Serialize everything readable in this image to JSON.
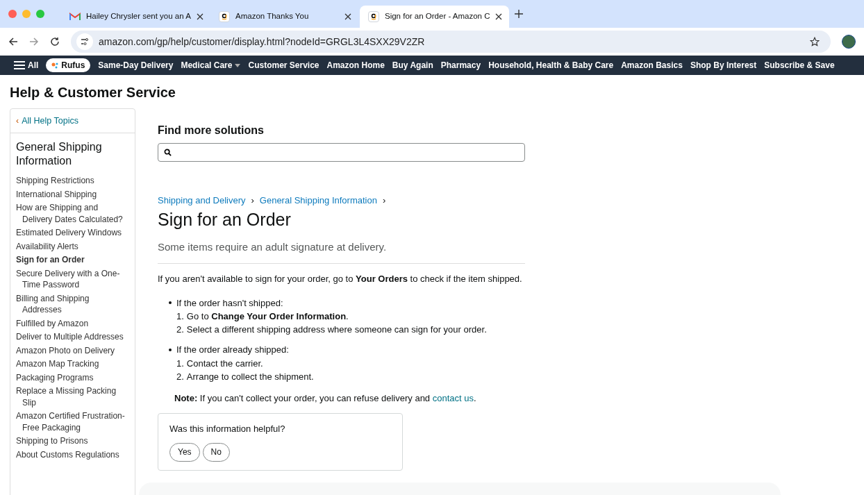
{
  "browser": {
    "tabs": [
      {
        "title": "Hailey Chrysler sent you an A",
        "kind": "mail",
        "selected": false
      },
      {
        "title": "Amazon Thanks You",
        "kind": "amazon",
        "selected": false
      },
      {
        "title": "Sign for an Order - Amazon C",
        "kind": "amazon",
        "selected": true
      }
    ],
    "url": "amazon.com/gp/help/customer/display.html?nodeId=GRGL3L4SXX29V2ZR"
  },
  "nav": {
    "all": "All",
    "rufus": "Rufus",
    "items": [
      {
        "label": "Same-Day Delivery",
        "dropdown": false
      },
      {
        "label": "Medical Care",
        "dropdown": true
      },
      {
        "label": "Customer Service",
        "dropdown": false
      },
      {
        "label": "Amazon Home",
        "dropdown": false
      },
      {
        "label": "Buy Again",
        "dropdown": false
      },
      {
        "label": "Pharmacy",
        "dropdown": false
      },
      {
        "label": "Household, Health & Baby Care",
        "dropdown": false
      },
      {
        "label": "Amazon Basics",
        "dropdown": false
      },
      {
        "label": "Shop By Interest",
        "dropdown": false
      },
      {
        "label": "Subscribe & Save",
        "dropdown": false
      }
    ]
  },
  "page_title": "Help & Customer Service",
  "sidebar": {
    "back_chevron": "‹",
    "back": "All Help Topics",
    "heading": "General Shipping Information",
    "items": [
      {
        "label": "Shipping Restrictions",
        "selected": false
      },
      {
        "label": "International Shipping",
        "selected": false
      },
      {
        "label": "How are Shipping and Delivery Dates Calculated?",
        "selected": false
      },
      {
        "label": "Estimated Delivery Windows",
        "selected": false
      },
      {
        "label": "Availability Alerts",
        "selected": false
      },
      {
        "label": "Sign for an Order",
        "selected": true
      },
      {
        "label": "Secure Delivery with a One-Time Password",
        "selected": false
      },
      {
        "label": "Billing and Shipping Addresses",
        "selected": false
      },
      {
        "label": "Fulfilled by Amazon",
        "selected": false
      },
      {
        "label": "Deliver to Multiple Addresses",
        "selected": false
      },
      {
        "label": "Amazon Photo on Delivery",
        "selected": false
      },
      {
        "label": "Amazon Map Tracking",
        "selected": false
      },
      {
        "label": "Packaging Programs",
        "selected": false
      },
      {
        "label": "Replace a Missing Packing Slip",
        "selected": false
      },
      {
        "label": "Amazon Certified Frustration-Free Packaging",
        "selected": false
      },
      {
        "label": "Shipping to Prisons",
        "selected": false
      },
      {
        "label": "About Customs Regulations",
        "selected": false
      }
    ]
  },
  "search": {
    "heading": "Find more solutions"
  },
  "breadcrumbs": [
    {
      "label": "Shipping and Delivery",
      "separator": "›"
    },
    {
      "label": "General Shipping Information",
      "separator": "›"
    }
  ],
  "article": {
    "title": "Sign for an Order",
    "summary": "Some items require an adult signature at delivery.",
    "intro": "If you aren't available to sign for your order, go to **Your Orders** to check if the item shipped.",
    "cases": [
      {
        "text": "If the order hasn't shipped:",
        "steps": [
          {
            "num": "1.",
            "text": "Go to **Change Your Order Information**."
          },
          {
            "num": "2.",
            "text": "Select a different shipping address where someone can sign for your order."
          }
        ]
      },
      {
        "text": "If the order already shipped:",
        "steps": [
          {
            "num": "1.",
            "text": "Contact the carrier."
          },
          {
            "num": "2.",
            "text": "Arrange to collect the shipment."
          }
        ]
      }
    ],
    "note": {
      "text": "**Note:** If you can't collect your order, you can refuse delivery and",
      "link": "contact us",
      "after": "."
    }
  },
  "feedback": {
    "question": "Was this information helpful?",
    "buttons": [
      "Yes",
      "No"
    ]
  }
}
